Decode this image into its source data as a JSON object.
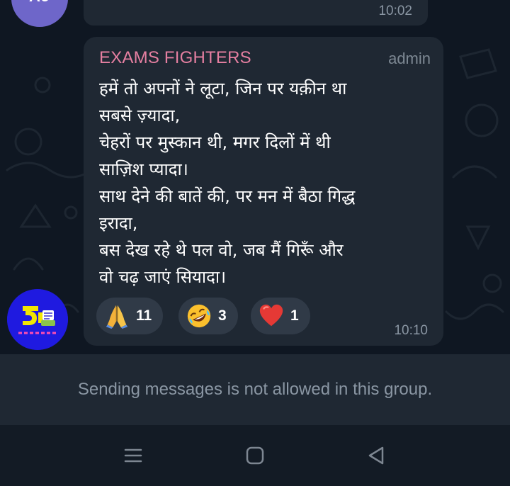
{
  "previous_message": {
    "avatar_initials": "AJ",
    "time": "10:02"
  },
  "message": {
    "sender": "EXAMS FIGHTERS",
    "role": "admin",
    "lines": [
      "हमें तो अपनों ने लूटा, जिन पर यक़ीन था",
      "सबसे ज़्यादा,",
      "चेहरों पर मुस्कान थी, मगर दिलों में थी",
      "साज़िश प्यादा।",
      "साथ देने की बातें की, पर मन में बैठा गिद्ध",
      "इरादा,",
      "बस देख रहे थे पल वो, जब मैं गिरूँ और",
      "वो चढ़ जाएं सियादा।"
    ],
    "reactions": [
      {
        "emoji": "folded-hands",
        "count": "11"
      },
      {
        "emoji": "rolling-on-floor-laughing",
        "count": "3"
      },
      {
        "emoji": "red-heart",
        "count": "1"
      }
    ],
    "time": "10:10"
  },
  "colors": {
    "sender_name": "#e57fa1",
    "bubble": "#1f2833",
    "background": "#0f1722",
    "channel_avatar": "#1f1ae0"
  },
  "footer": {
    "notice": "Sending messages is not allowed in this group."
  },
  "nav_bar": {
    "buttons": [
      "menu-icon",
      "home-icon",
      "back-icon"
    ]
  }
}
